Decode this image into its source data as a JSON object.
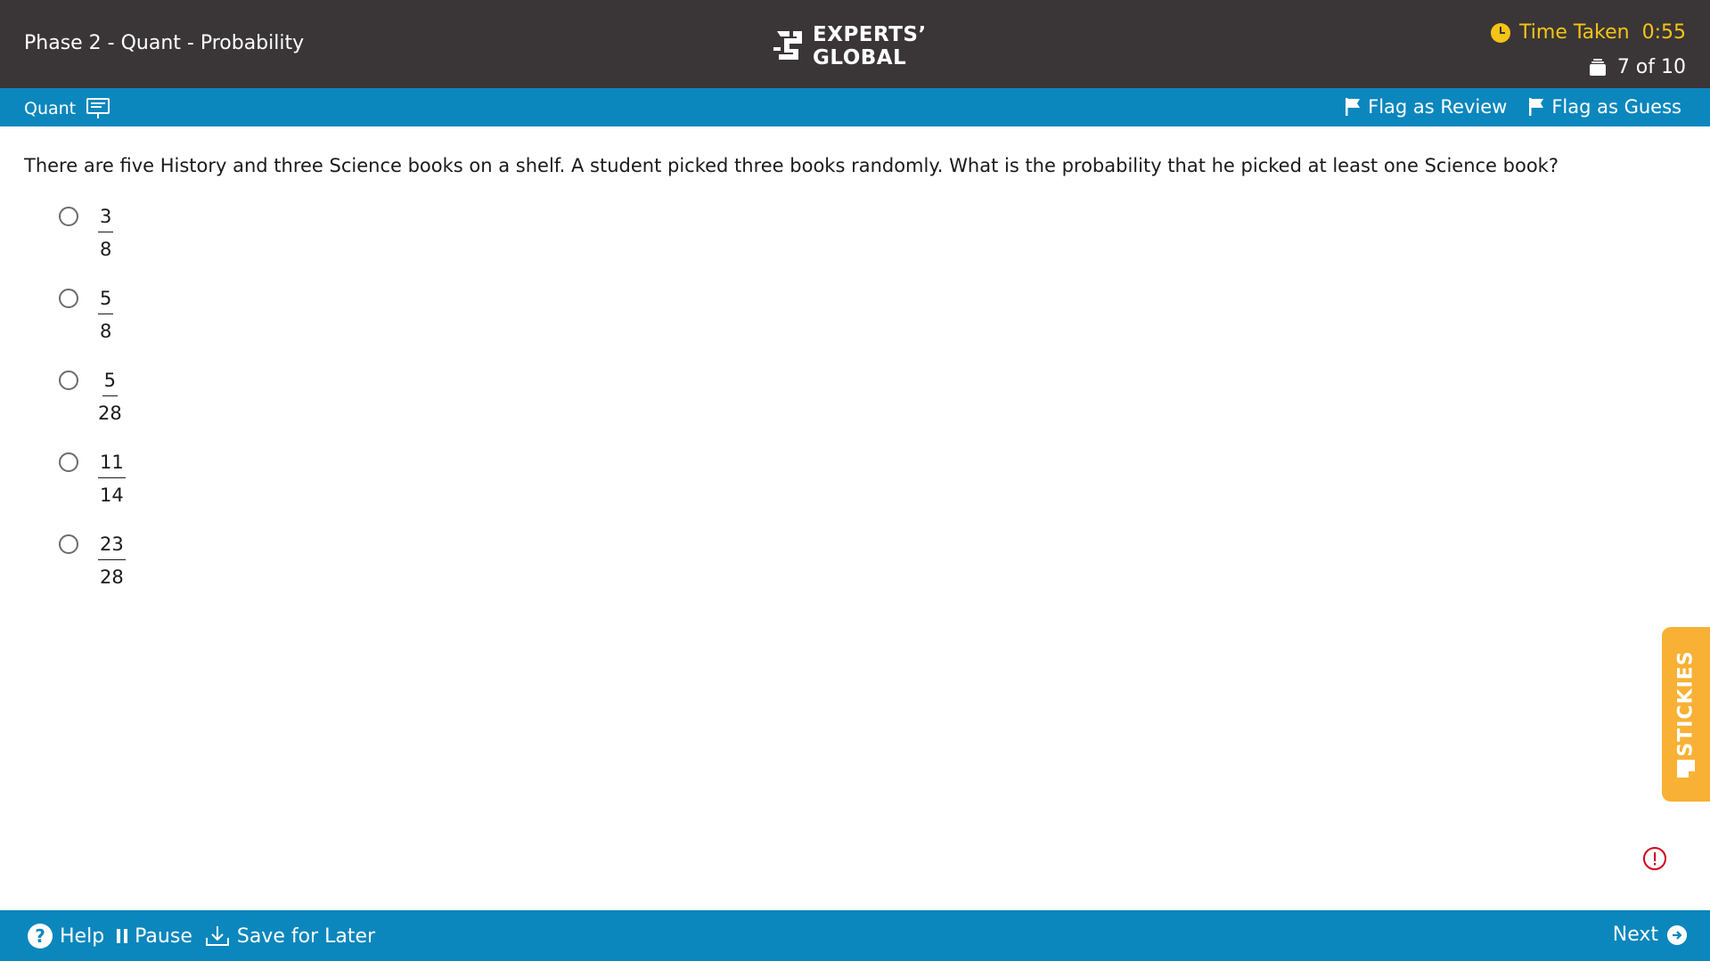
{
  "header": {
    "title": "Phase 2 - Quant - Probability",
    "logo_line1": "EXPERTS’",
    "logo_line2": "GLOBAL",
    "timer_label": "Time Taken",
    "timer_value": "0:55",
    "progress": "7 of 10"
  },
  "section_bar": {
    "section": "Quant",
    "flag_review": "Flag as Review",
    "flag_guess": "Flag as Guess"
  },
  "question": {
    "text": "There are five History and three Science books on a shelf. A student picked three books randomly. What is the probability that he picked at least one Science book?",
    "options": [
      {
        "num": "3",
        "den": "8"
      },
      {
        "num": "5",
        "den": "8"
      },
      {
        "num": "5",
        "den": "28"
      },
      {
        "num": "11",
        "den": "14"
      },
      {
        "num": "23",
        "den": "28"
      }
    ]
  },
  "stickies": {
    "label": "STICKIES"
  },
  "footer": {
    "help": "Help",
    "pause": "Pause",
    "save": "Save for Later",
    "next": "Next"
  },
  "colors": {
    "header_bg": "#3a3637",
    "bar_blue": "#0b87bd",
    "timer_yellow": "#f6c416",
    "stickies_orange": "#f8b134",
    "alert_red": "#d0021b"
  }
}
